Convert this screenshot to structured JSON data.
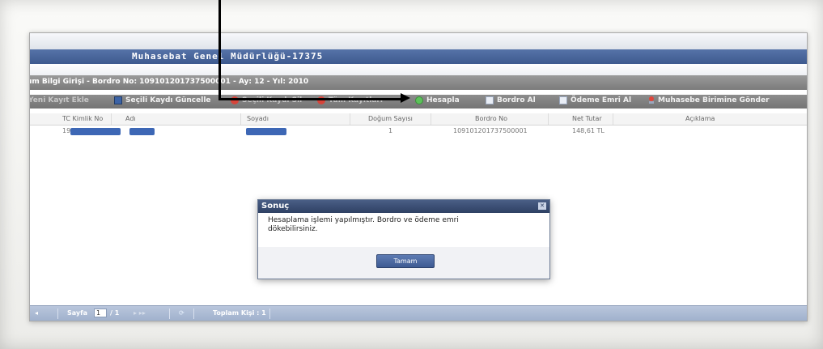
{
  "app": {
    "title": "Muhasebat Genel Müdürlüğü-17375"
  },
  "panel": {
    "title": "um Bilgi Girişi - Bordro No: 109101201737500001 - Ay: 12 - Yıl: 2010"
  },
  "toolbar": {
    "new_record": "Yeni Kayıt Ekle",
    "update_selected": "Seçili Kaydı Güncelle",
    "delete_selected": "Seçili Kaydı Sil",
    "delete_all": "Tüm Kayıtları",
    "calculate": "Hesapla",
    "get_payroll": "Bordro Al",
    "get_payment_order": "Ödeme Emri Al",
    "send_to_accounting": "Muhasebe Birimine Gönder"
  },
  "grid": {
    "columns": [
      "TC Kimlik No",
      "Adı",
      "Soyadı",
      "Doğum Sayısı",
      "Bordro No",
      "Net Tutar",
      "Açıklama"
    ],
    "rows": [
      {
        "tc": "19",
        "birth_count": "1",
        "payroll_no": "109101201737500001",
        "net_amount": "148,61 TL"
      }
    ]
  },
  "status_bar": {
    "page_label": "Sayfa",
    "page_value": "1",
    "page_total": "/ 1",
    "total_label": "Toplam Kişi : 1"
  },
  "dialog": {
    "title": "Sonuç",
    "message": "Hesaplama işlemi yapılmıştır. Bordro ve ödeme emri dökebilirsiniz.",
    "ok_button": "Tamam",
    "close_glyph": "✕"
  },
  "colors": {
    "header_blue": "#3e5a8f",
    "redaction_blue": "#3d67b5",
    "toolbar_gray": "#7b7b7b"
  }
}
